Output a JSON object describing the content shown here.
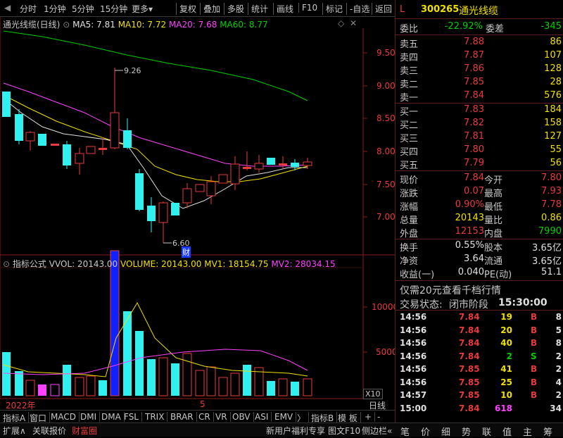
{
  "toolbar": {
    "period1": "分时",
    "period2": "1分钟",
    "period3": "5分钟",
    "period4": "15分钟",
    "more": "更多",
    "restore": "复权",
    "overlay": "叠加",
    "multi": "多股",
    "stats": "统计",
    "draw": "画线",
    "f10": "F10",
    "mark": "标记",
    "addfav": "-自选",
    "back": "返回"
  },
  "chart": {
    "title": "通光线缆(日线)",
    "ma5": "MA5: 7.81",
    "ma10": "MA10: 7.72",
    "ma20": "MA20: 7.68",
    "ma60": "MA60: 8.77",
    "high_mark": "9.26",
    "low_mark": "6.60",
    "fin_badge": "财",
    "year": "2022年",
    "month": "5"
  },
  "price_axis": [
    "9.50",
    "9.00",
    "8.50",
    "8.00",
    "7.50",
    "7.00"
  ],
  "indicator": {
    "title": "指标公式",
    "vol": "VVOL: 20143.00",
    "volume": "VOLUME: 20143.00",
    "mv1": "MV1: 18154.75",
    "mv2": "MV2: 28034.15",
    "unit": "X10"
  },
  "vol_axis": [
    "10000",
    "5000"
  ],
  "colors": {
    "up": "#e83b3b",
    "down": "#30f0f0",
    "ma5": "#e0e0e0",
    "ma10": "#f0e000",
    "ma20": "#ff40ff",
    "ma60": "#00d000"
  },
  "bottom_tabs": [
    "指标A",
    "窗口",
    "MACD",
    "DMI",
    "DMA",
    "FSL",
    "TRIX",
    "BRAR",
    "CR",
    "VR",
    "OBV",
    "ASI",
    "EMV",
    "〉",
    "指标B",
    "模 板",
    "+",
    "-",
    "日线"
  ],
  "status": {
    "expand": "扩展∧",
    "concern": "关联报价",
    "finance": "财富圈",
    "promo": "新用户福利专享",
    "f10": "图文F10",
    "side": "侧边栏«"
  },
  "quote": {
    "market_flag": "L",
    "code": "300265",
    "name": "通光线缆",
    "weibi_label": "委比",
    "weibi": "-22.92%",
    "weicha_label": "委差",
    "weicha": "-345",
    "sells": [
      {
        "label": "卖五",
        "price": "7.88",
        "vol": "86"
      },
      {
        "label": "卖四",
        "price": "7.87",
        "vol": "107"
      },
      {
        "label": "卖三",
        "price": "7.86",
        "vol": "128"
      },
      {
        "label": "卖二",
        "price": "7.85",
        "vol": "28"
      },
      {
        "label": "卖一",
        "price": "7.84",
        "vol": "576"
      }
    ],
    "buys": [
      {
        "label": "买一",
        "price": "7.83",
        "vol": "184"
      },
      {
        "label": "买二",
        "price": "7.82",
        "vol": "158"
      },
      {
        "label": "买三",
        "price": "7.81",
        "vol": "127"
      },
      {
        "label": "买四",
        "price": "7.80",
        "vol": "55"
      },
      {
        "label": "买五",
        "price": "7.79",
        "vol": "56"
      }
    ],
    "stats": [
      {
        "l1": "现价",
        "v1": "7.84",
        "l2": "今开",
        "v2": "7.80"
      },
      {
        "l1": "涨跌",
        "v1": "0.07",
        "l2": "最高",
        "v2": "7.93"
      },
      {
        "l1": "涨幅",
        "v1": "0.90%",
        "l2": "最低",
        "v2": "7.78"
      },
      {
        "l1": "总量",
        "v1": "20143",
        "l2": "量比",
        "v2": "0.86"
      },
      {
        "l1": "外盘",
        "v1": "12153",
        "l2": "内盘",
        "v2": "7990"
      }
    ],
    "stats2": [
      {
        "l1": "换手",
        "v1": "0.55%",
        "l2": "股本",
        "v2": "3.65亿"
      },
      {
        "l1": "净资",
        "v1": "3.64",
        "l2": "流通",
        "v2": "3.65亿"
      },
      {
        "l1": "收益(一)",
        "v1": "0.040",
        "l2": "PE(动)",
        "v2": "51.1"
      }
    ],
    "promo": "仅需20元查看千档行情",
    "trade_status_label": "交易状态:",
    "trade_status": "闭市阶段",
    "trade_time": "15:30:00",
    "ticks": [
      {
        "t": "14:56",
        "p": "7.84",
        "v": "19",
        "s": "B",
        "n": "8"
      },
      {
        "t": "14:56",
        "p": "7.84",
        "v": "20",
        "s": "B",
        "n": "5"
      },
      {
        "t": "14:56",
        "p": "7.84",
        "v": "40",
        "s": "B",
        "n": "8"
      },
      {
        "t": "14:56",
        "p": "7.84",
        "v": "2",
        "s": "S",
        "n": "2"
      },
      {
        "t": "14:56",
        "p": "7.85",
        "v": "41",
        "s": "B",
        "n": "2"
      },
      {
        "t": "14:56",
        "p": "7.85",
        "v": "25",
        "s": "B",
        "n": "4"
      },
      {
        "t": "14:57",
        "p": "7.85",
        "v": "10",
        "s": "B",
        "n": "2"
      },
      {
        "t": "15:00",
        "p": "7.84",
        "v": "618",
        "s": "",
        "n": "34"
      }
    ],
    "tabs": [
      "笔",
      "价",
      "细",
      "势",
      "联",
      "值",
      "主",
      "筹"
    ]
  }
}
